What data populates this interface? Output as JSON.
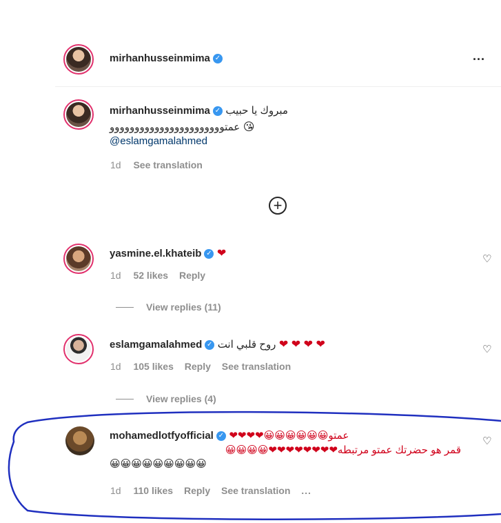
{
  "header": {
    "username": "mirhanhusseinmima",
    "more_icon": "more-horizontal-icon",
    "more_label": "..."
  },
  "caption": {
    "username": "mirhanhusseinmima",
    "text_line1": "مبروك يا حبيب",
    "text_line2": "عمتووووووووووووووووووووووو",
    "mention": "@eslamgamalahmed",
    "time": "1d",
    "see_translation": "See translation"
  },
  "load_more_icon": "circle-plus-icon",
  "comments": [
    {
      "username": "yasmine.el.khateib",
      "text": "",
      "emoji": "❤",
      "time": "1d",
      "likes": "52 likes",
      "reply": "Reply",
      "view_replies": "View replies (11)"
    },
    {
      "username": "eslamgamalahmed",
      "text": "روح قلبي انت",
      "emoji": "❤ ❤ ❤ ❤",
      "time": "1d",
      "likes": "105 likes",
      "reply": "Reply",
      "see_translation": "See translation",
      "view_replies": "View replies (4)"
    },
    {
      "username": "mohamedlotfyofficial",
      "text_line1": "عمتو😀😀😀😀😀😀❤❤❤❤",
      "text_line2": "قمر هو حضرتك عمتو مرتبطه❤❤❤❤❤❤❤❤😀😀😀😀",
      "text_line3": "😀😀😀😀😀😀😀😀😀",
      "time": "1d",
      "likes": "110 likes",
      "reply": "Reply",
      "see_translation": "See translation",
      "more_label": "..."
    }
  ],
  "colors": {
    "annotation_stroke": "#1f2fbf",
    "verified": "#3897f0",
    "heart": "#d0021b",
    "muted": "#8e8e8e"
  }
}
